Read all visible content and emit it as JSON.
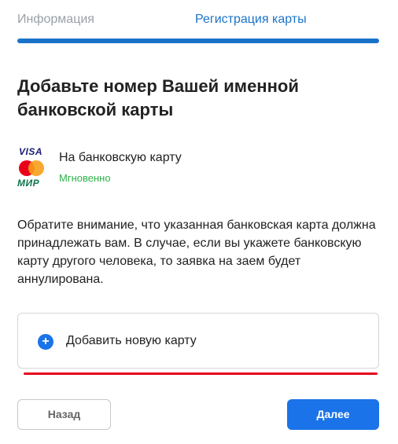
{
  "tabs": {
    "info_label": "Информация",
    "registration_label": "Регистрация карты"
  },
  "progress": {
    "fraction": 1.0
  },
  "heading": "Добавьте номер Вашей именной банковской карты",
  "payment_method": {
    "visa_logo": "VISA",
    "mir_logo": "МИР",
    "title": "На банковскую карту",
    "subtitle": "Мгновенно"
  },
  "notice": "Обратите внимание, что указанная банковская карта должна принадлежать вам. В случае, если вы укажете банковскую карту другого человека, то заявка на заем будет аннулирована.",
  "add_card": {
    "icon": "plus-circle-icon",
    "label": "Добавить новую карту"
  },
  "buttons": {
    "back_label": "Назад",
    "next_label": "Далее"
  },
  "colors": {
    "accent": "#1a73e8",
    "tab_active": "#1a73c9",
    "success": "#2db34a",
    "highlight_line": "#e5001c"
  }
}
